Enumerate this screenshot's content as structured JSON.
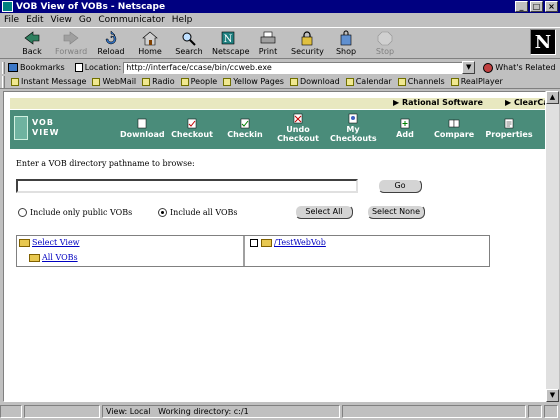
{
  "window": {
    "title": "VOB View of VOBs - Netscape",
    "buttons": [
      "_",
      "□",
      "×"
    ]
  },
  "menu": [
    "File",
    "Edit",
    "View",
    "Go",
    "Communicator",
    "Help"
  ],
  "nav": {
    "back": "Back",
    "forward": "Forward",
    "reload": "Reload",
    "home": "Home",
    "search": "Search",
    "netscape": "Netscape",
    "print": "Print",
    "security": "Security",
    "shop": "Shop",
    "stop": "Stop",
    "logo": "N"
  },
  "location": {
    "bookmarks": "Bookmarks",
    "label": "Location:",
    "url": "http://interface/ccase/bin/ccweb.exe",
    "whats_related": "What's Related"
  },
  "personal": [
    "Instant Message",
    "WebMail",
    "Radio",
    "People",
    "Yellow Pages",
    "Download",
    "Calendar",
    "Channels",
    "RealPlayer"
  ],
  "rational": {
    "rational_software": "▶ Rational Software",
    "clearcase": "▶ ClearCase I"
  },
  "vob_toolbar": {
    "logo_line1": "VOB",
    "logo_line2": "VIEW",
    "download": "Download",
    "checkout": "Checkout",
    "checkin": "Checkin",
    "undo1": "Undo",
    "undo2": "Checkout",
    "my1": "My",
    "my2": "Checkouts",
    "add": "Add",
    "compare": "Compare",
    "properties": "Properties"
  },
  "form": {
    "prompt": "Enter a VOB directory pathname to browse:",
    "go": "Go",
    "radio_public": "Include only public VOBs",
    "radio_all": "Include all VOBs",
    "select_all": "Select All",
    "select_none": "Select None"
  },
  "tree": {
    "select_view": "Select View",
    "all_vobs": "All VOBs",
    "vob_item": "/TestWebVob"
  },
  "status": {
    "view": "View: Local",
    "working_dir": "Working directory: c:/1"
  },
  "colors": {
    "title_bar": "#000080",
    "vob_toolbar": "#4a8c7a",
    "link": "#0000c0",
    "rational_bar": "#e8e8c0"
  }
}
